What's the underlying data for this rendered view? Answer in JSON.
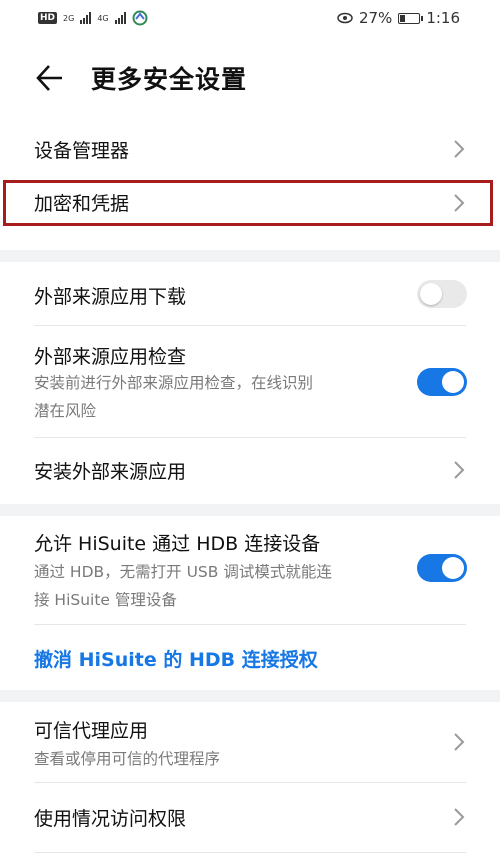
{
  "status_bar": {
    "hd": "HD",
    "hd_sub": "2",
    "net1": "2G",
    "net2": "4G",
    "battery_percent": "27%",
    "battery_level": 0.27,
    "time": "1:16"
  },
  "header": {
    "title": "更多安全设置"
  },
  "items": {
    "device_manager": "设备管理器",
    "encryption": "加密和凭据",
    "external_download": {
      "label": "外部来源应用下载",
      "enabled": false
    },
    "external_check": {
      "label": "外部来源应用检查",
      "desc_line1": "安装前进行外部来源应用检查，在线识别",
      "desc_line2": "潜在风险",
      "enabled": true
    },
    "install_external": "安装外部来源应用",
    "hisuite": {
      "label": "允许 HiSuite 通过 HDB 连接设备",
      "desc_line1": "通过 HDB，无需打开 USB 调试模式就能连",
      "desc_line2": "接 HiSuite 管理设备",
      "enabled": true
    },
    "revoke": "撤消 HiSuite 的 HDB 连接授权",
    "trust_agent": {
      "label": "可信代理应用",
      "desc": "查看或停用可信的代理程序"
    },
    "usage_access": "使用情况访问权限"
  },
  "colors": {
    "accent": "#1677e5",
    "highlight": "#a71d1d"
  }
}
